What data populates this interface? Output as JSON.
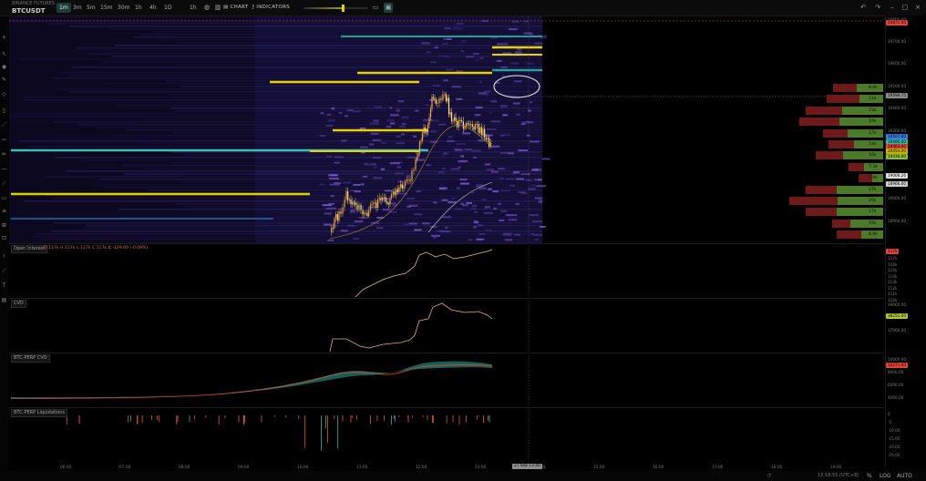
{
  "app": {
    "exchange": "BINANCE FUTURES",
    "symbol": "BTCUSDT"
  },
  "toolbar": {
    "timeframes": [
      "1m",
      "3m",
      "5m",
      "15m",
      "30m",
      "1h",
      "4h",
      "1D"
    ],
    "active_timeframe": "1m",
    "interval_button": "1h",
    "chart_button": "CHART",
    "indicators_button": "INDICATORS",
    "heatmap_intensity": 0.62
  },
  "panes": {
    "open_interest": {
      "label": "Open Interest",
      "ohlc": "O:117k H:117k L:117k C:117k Δ:-109.00 (-0.09%)",
      "ticks": [
        "117k",
        "116k",
        "115k",
        "114k",
        "113k",
        "112k",
        "111k",
        "110k"
      ],
      "last": "117k"
    },
    "cvd": {
      "label": "CVD",
      "ticks": [
        "39000.00",
        "38000.00",
        "37000.00"
      ],
      "last": "38251.00"
    },
    "perp_cvd": {
      "label": "BTC-PERP CVD",
      "ticks": [
        "10000.00",
        "8000.00",
        "6000.00",
        "4000.00"
      ],
      "last": "10271.00"
    },
    "liquidations": {
      "label": "BTC-PERP Liquidations",
      "ticks": [
        "0",
        "-5",
        "-10.00",
        "-15.00",
        "-20.00",
        "-25.00"
      ]
    }
  },
  "price_axis": {
    "ticks": [
      "19800.00",
      "19700.00",
      "19600.00",
      "19500.00",
      "19400.00",
      "19300.00",
      "19200.00",
      "19100.00",
      "19000.00",
      "18900.00"
    ],
    "tags": [
      {
        "text": "19871.00",
        "color": "#e0453a"
      },
      {
        "text": "19599.75",
        "color": "#8d8d8d"
      },
      {
        "text": "19507.00",
        "color": "#3a7be0"
      },
      {
        "text": "19466.00",
        "color": "#32b8a0"
      },
      {
        "text": "19463.00",
        "color": "#e0453a"
      },
      {
        "text": "19454.00",
        "color": "#c8b400"
      },
      {
        "text": "19430.00",
        "color": "#8fbf3a"
      },
      {
        "text": "19006.26",
        "color": "#e0e0e0"
      },
      {
        "text": "18966.00",
        "color": "#cfcfcf"
      }
    ]
  },
  "volume_profile": [
    {
      "label": "8.6k",
      "sell": 0.3,
      "buy": 0.34
    },
    {
      "label": "11k",
      "sell": 0.42,
      "buy": 0.3
    },
    {
      "label": "23k",
      "sell": 0.47,
      "buy": 0.53
    },
    {
      "label": "29k",
      "sell": 0.52,
      "buy": 0.56
    },
    {
      "label": "17k",
      "sell": 0.31,
      "buy": 0.46
    },
    {
      "label": "14k",
      "sell": 0.33,
      "buy": 0.37
    },
    {
      "label": "16k",
      "sell": 0.35,
      "buy": 0.52
    },
    {
      "label": "7.1k",
      "sell": 0.2,
      "buy": 0.24
    },
    {
      "label": "5.9k",
      "sell": 0.18,
      "buy": 0.14
    },
    {
      "label": "27k",
      "sell": 0.4,
      "buy": 0.6
    },
    {
      "label": "29k",
      "sell": 0.62,
      "buy": 0.58
    },
    {
      "label": "27k",
      "sell": 0.4,
      "buy": 0.6
    },
    {
      "label": "19k",
      "sell": 0.24,
      "buy": 0.42
    },
    {
      "label": "8.9k",
      "sell": 0.32,
      "buy": 0.28
    }
  ],
  "time_axis": {
    "ticks": [
      "06:00",
      "07:00",
      "08:00",
      "09:00",
      "10:00",
      "11:00",
      "12:00",
      "13:00",
      "14:00",
      "15:00",
      "16:00",
      "17:00",
      "18:00",
      "19:00"
    ],
    "crosshair_label": "27 Sep 13:40"
  },
  "footer": {
    "timezone": "13:18:55 (UTC+8)",
    "log": "LOG",
    "auto": "AUTO",
    "percent": "%"
  }
}
